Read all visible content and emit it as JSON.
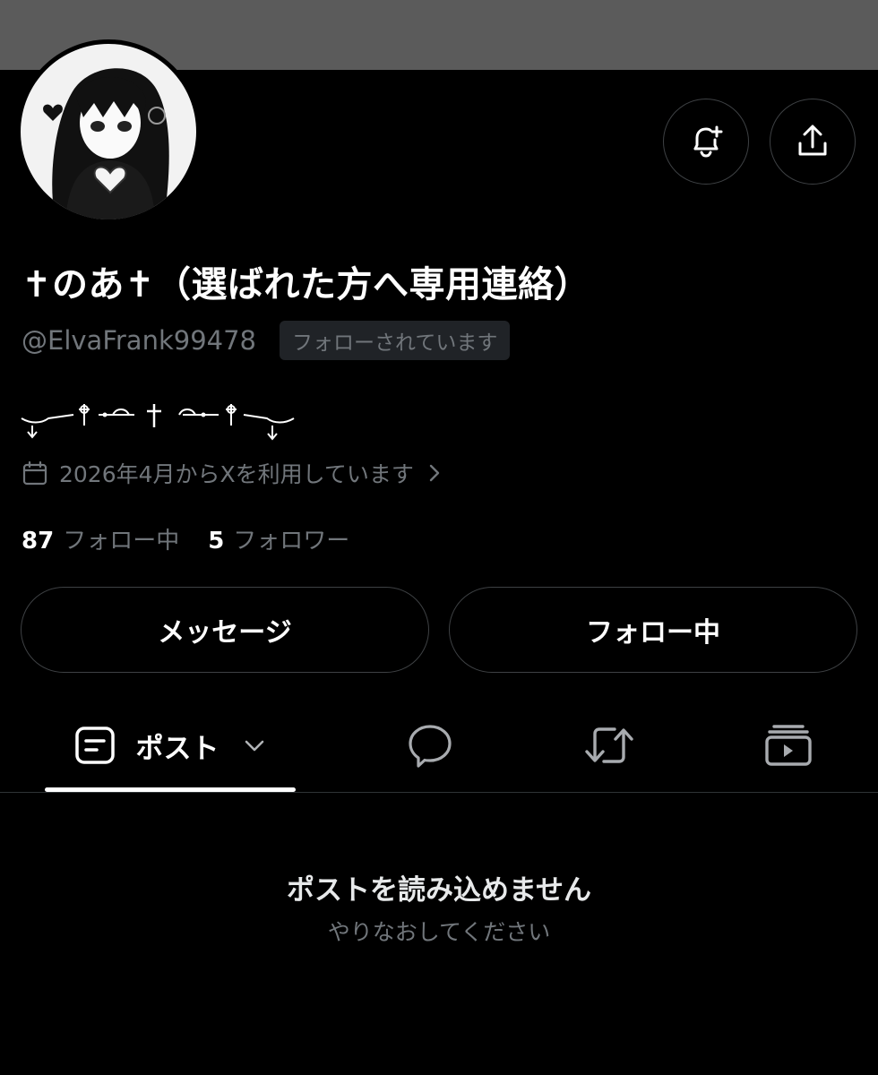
{
  "profile": {
    "display_name": "✝のあ✝（選ばれた方へ専用連絡）",
    "handle": "@ElvaFrank99478",
    "follows_you_badge": "フォローされています",
    "joined_text": "2026年4月からXを利用しています",
    "following_count": "87",
    "following_label": "フォロー中",
    "followers_count": "5",
    "followers_label": "フォロワー"
  },
  "actions": {
    "message_label": "メッセージ",
    "following_button_label": "フォロー中"
  },
  "tabs": {
    "posts_label": "ポスト"
  },
  "empty_state": {
    "title": "ポストを読み込めません",
    "subtitle": "やりなおしてください"
  },
  "icons": {
    "notify": "bell-plus-icon",
    "share": "share-icon",
    "calendar": "calendar-icon",
    "chevron": "chevron-right-icon",
    "posts": "posts-icon",
    "replies": "speech-bubble-icon",
    "reposts": "repost-icon",
    "media": "media-icon"
  },
  "colors": {
    "background": "#000000",
    "banner": "#5b5b5b",
    "primary_text": "#e7e9ea",
    "secondary_text": "#71767b",
    "border": "#3e4144",
    "badge_bg": "#202327"
  }
}
